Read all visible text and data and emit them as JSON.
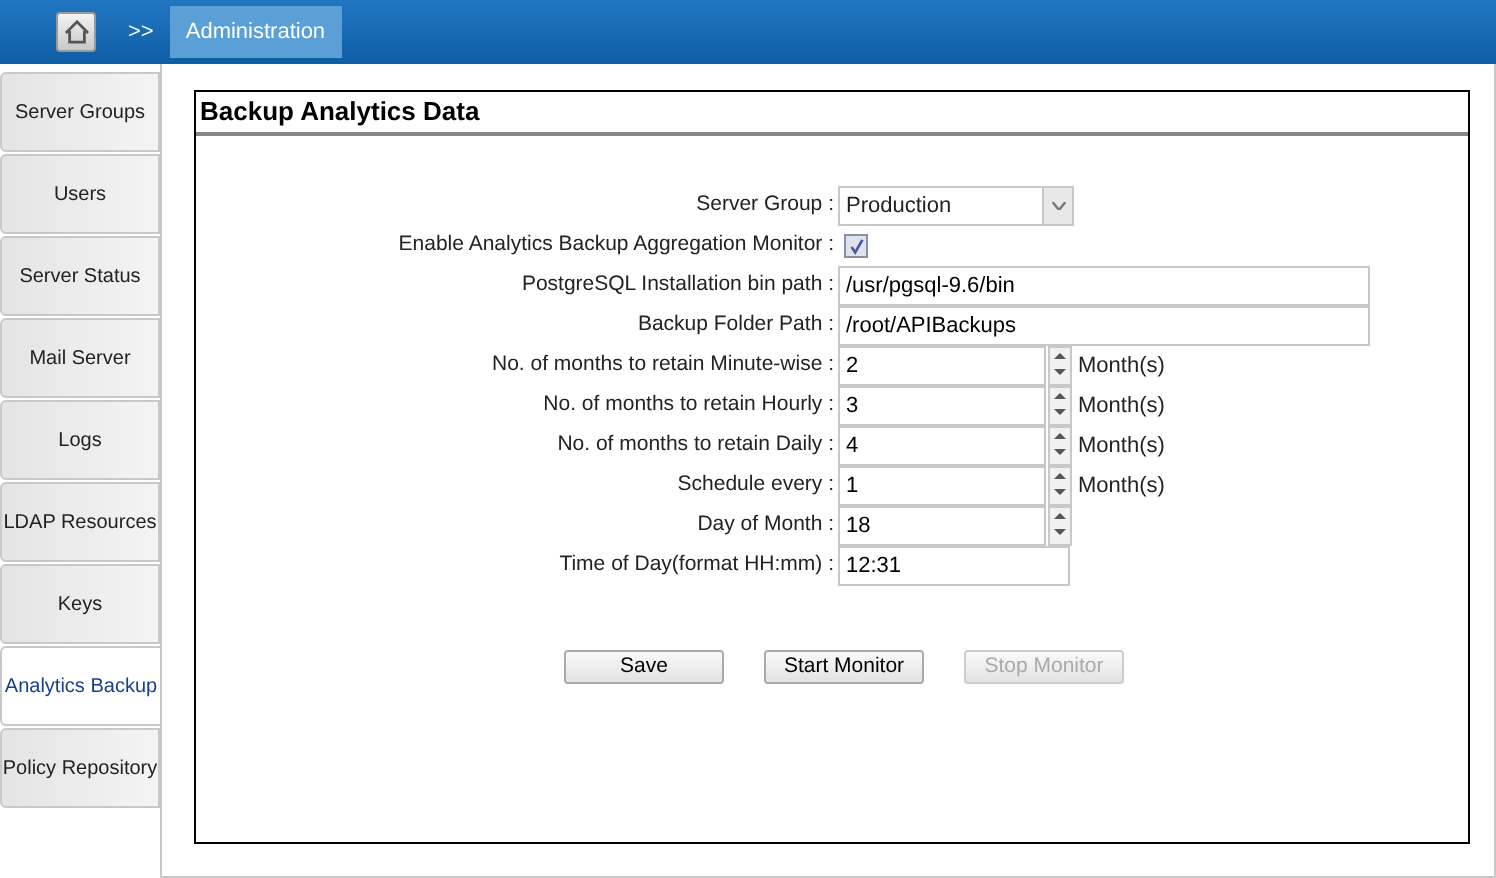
{
  "topbar": {
    "separator": ">>",
    "breadcrumb": "Administration"
  },
  "sidebar": {
    "items": [
      {
        "label": "Server Groups",
        "selected": false
      },
      {
        "label": "Users",
        "selected": false
      },
      {
        "label": "Server Status",
        "selected": false
      },
      {
        "label": "Mail Server",
        "selected": false
      },
      {
        "label": "Logs",
        "selected": false
      },
      {
        "label": "LDAP Resources",
        "selected": false
      },
      {
        "label": "Keys",
        "selected": false
      },
      {
        "label": "Analytics Backup",
        "selected": true
      },
      {
        "label": "Policy Repository",
        "selected": false
      }
    ]
  },
  "panel": {
    "title": "Backup Analytics Data",
    "fields": [
      {
        "kind": "select",
        "label": "Server Group :",
        "value": "Production"
      },
      {
        "kind": "checkbox",
        "label": "Enable Analytics Backup Aggregation Monitor :",
        "checked": true
      },
      {
        "kind": "text",
        "label": "PostgreSQL Installation bin path :",
        "value": "/usr/pgsql-9.6/bin"
      },
      {
        "kind": "text",
        "label": "Backup Folder Path :",
        "value": "/root/APIBackups"
      },
      {
        "kind": "spinner",
        "label": "No. of months to retain Minute-wise :",
        "value": "2",
        "unit": "Month(s)"
      },
      {
        "kind": "spinner",
        "label": "No. of months to retain Hourly :",
        "value": "3",
        "unit": "Month(s)"
      },
      {
        "kind": "spinner",
        "label": "No. of months to retain Daily :",
        "value": "4",
        "unit": "Month(s)"
      },
      {
        "kind": "spinner",
        "label": "Schedule every :",
        "value": "1",
        "unit": "Month(s)"
      },
      {
        "kind": "spinner",
        "label": "Day of Month :",
        "value": "18"
      },
      {
        "kind": "short",
        "label": "Time of Day(format HH:mm) :",
        "value": "12:31"
      }
    ],
    "buttons": [
      {
        "label": "Save",
        "disabled": false
      },
      {
        "label": "Start Monitor",
        "disabled": false
      },
      {
        "label": "Stop Monitor",
        "disabled": true
      }
    ]
  }
}
